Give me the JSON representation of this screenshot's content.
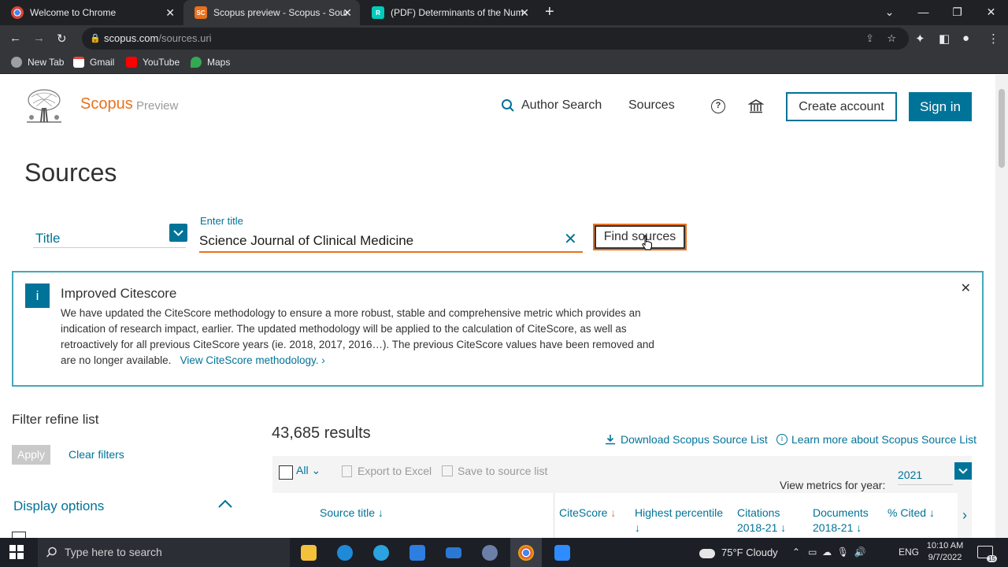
{
  "browser": {
    "tabs": [
      {
        "title": "Welcome to Chrome",
        "favicon": "chrome-icon"
      },
      {
        "title": "Scopus preview - Scopus - Sourc",
        "favicon": "scopus-icon"
      },
      {
        "title": "(PDF) Determinants of the Numb",
        "favicon": "researchgate-icon"
      }
    ],
    "new_tab": "+",
    "url_domain": "scopus.com",
    "url_path": "/sources.uri",
    "bookmarks": [
      "New Tab",
      "Gmail",
      "YouTube",
      "Maps"
    ]
  },
  "header": {
    "brand": "Scopus",
    "brand_sub": "Preview",
    "nav": {
      "author_search": "Author Search",
      "sources": "Sources"
    },
    "create_account": "Create account",
    "sign_in": "Sign in"
  },
  "search": {
    "heading": "Sources",
    "field_type": "Title",
    "input_label": "Enter title",
    "input_value": "Science Journal of Clinical Medicine",
    "find_button": "Find sources"
  },
  "banner": {
    "title": "Improved Citescore",
    "body": "We have updated the CiteScore methodology to ensure a more robust, stable and comprehensive metric which provides an indication of research impact, earlier. The updated methodology will be applied to the calculation of CiteScore, as well as retroactively for all previous CiteScore years (ie. 2018, 2017, 2016…). The previous CiteScore values have been removed and are no longer available.",
    "link": "View CiteScore methodology."
  },
  "filters": {
    "heading": "Filter refine list",
    "apply": "Apply",
    "clear": "Clear filters",
    "display_options": "Display options"
  },
  "results": {
    "count": "43,685 results",
    "download": "Download Scopus Source List",
    "learn_more": "Learn more about Scopus Source List",
    "select_all": "All",
    "export": "Export to Excel",
    "save": "Save to source list",
    "view_metrics_label": "View metrics for year:",
    "year": "2021",
    "columns": {
      "source_title": "Source title",
      "citescore": "CiteScore",
      "highest_percentile": "Highest percentile",
      "citations_1": "Citations",
      "citations_2": "2018-21",
      "documents_1": "Documents",
      "documents_2": "2018-21",
      "cited": "% Cited"
    }
  },
  "taskbar": {
    "search_placeholder": "Type here to search",
    "weather": "75°F  Cloudy",
    "lang": "ENG",
    "time": "10:10 AM",
    "date": "9/7/2022",
    "notif_count": "15"
  },
  "colors": {
    "accent": "#007398",
    "orange": "#e9711c",
    "chrome_dark": "#202124"
  }
}
